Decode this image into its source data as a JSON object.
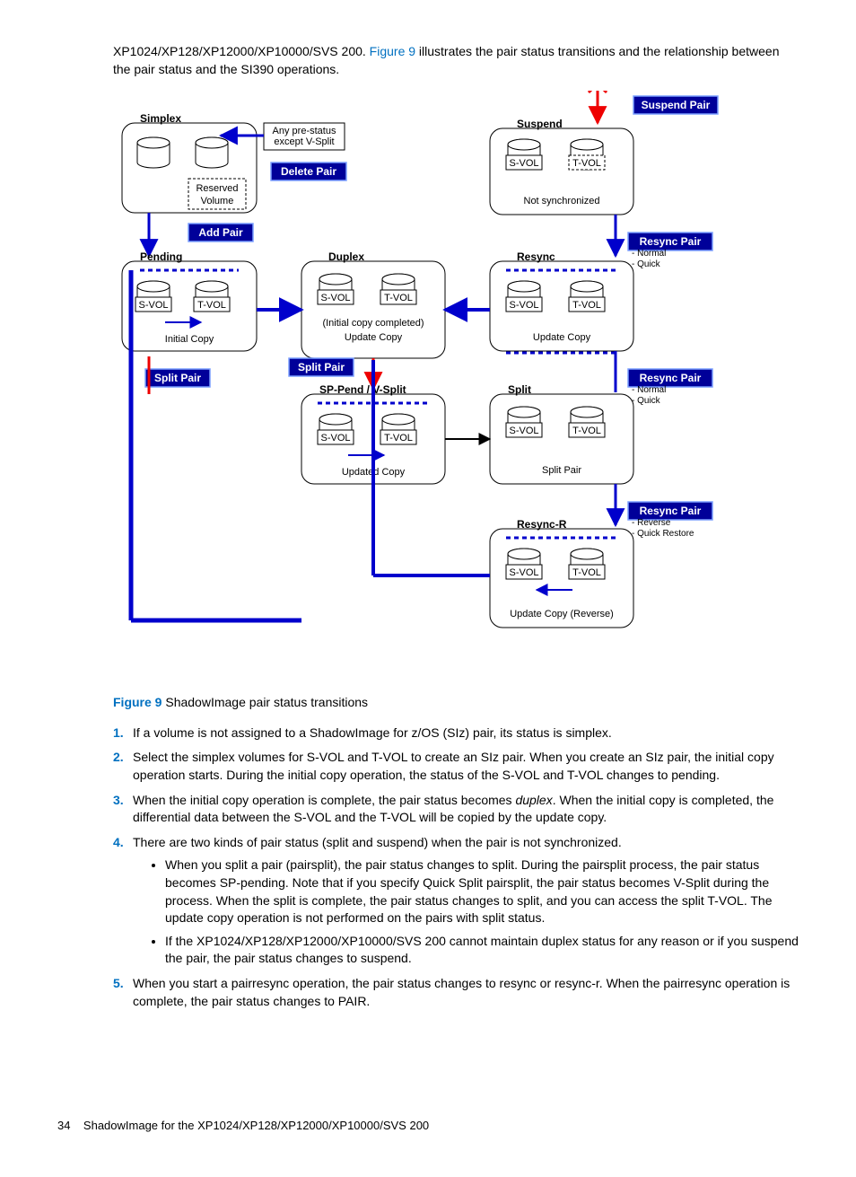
{
  "intro": {
    "prefix": "XP1024/XP128/XP12000/XP10000/SVS 200. ",
    "figref": "Figure 9",
    "suffix": " illustrates the pair status transitions and the relationship between the pair status and the SI390 operations."
  },
  "diagram": {
    "buttons": {
      "suspend": "Suspend Pair",
      "delete": "Delete Pair",
      "add": "Add Pair",
      "resync": "Resync Pair",
      "split": "Split Pair"
    },
    "states": {
      "simplex": "Simplex",
      "pending": "Pending",
      "duplex": "Duplex",
      "suspend": "Suspend",
      "resync": "Resync",
      "sppend": "SP-Pend / V-Split",
      "split": "Split",
      "resyncr": "Resync-R"
    },
    "labels": {
      "anypre1": "Any pre-status",
      "anypre2": "except V-Split",
      "reserved": "Reserved",
      "volume": "Volume",
      "svol": "S-VOL",
      "tvol": "T-VOL",
      "notsync": "Not synchronized",
      "initialcopy": "Initial Copy",
      "initialcomplete": "(Initial copy completed)",
      "updatecopy": "Update Copy",
      "updatedcopy": "Updated Copy",
      "splitpair": "Split Pair",
      "updatecopyrev": "Update Copy (Reverse)",
      "normal": "- Normal",
      "quick": "- Quick",
      "reverse": "- Reverse",
      "quickrestore": "- Quick Restore"
    }
  },
  "caption": {
    "label": "Figure 9",
    "text": "  ShadowImage pair status transitions"
  },
  "list": {
    "i1": "If a volume is not assigned to a ShadowImage for z/OS (SIz) pair, its status is simplex.",
    "i2": "Select the simplex volumes for S-VOL and T-VOL to create an SIz pair. When you create an SIz pair, the initial copy operation starts. During the initial copy operation, the status of the S-VOL and T-VOL changes to pending.",
    "i3a": "When the initial copy operation is complete, the pair status becomes ",
    "i3b": "duplex",
    "i3c": ". When the initial copy is completed, the differential data between the S-VOL and the T-VOL will be copied by the update copy.",
    "i4": "There are two kinds of pair status (split and suspend) when the pair is not synchronized.",
    "i4a": "When you split a pair (pairsplit), the pair status changes to split. During the pairsplit process, the pair status becomes SP-pending. Note that if you specify Quick Split pairsplit, the pair status becomes V-Split during the process. When the split is complete, the pair status changes to split, and you can access the split T-VOL. The update copy operation is not performed on the pairs with split status.",
    "i4b": "If the XP1024/XP128/XP12000/XP10000/SVS 200 cannot maintain duplex status for any reason or if you suspend the pair, the pair status changes to suspend.",
    "i5": "When you start a pairresync operation, the pair status changes to resync or resync-r. When the pairresync operation is complete, the pair status changes to PAIR."
  },
  "footer": {
    "page": "34",
    "title": "ShadowImage for the XP1024/XP128/XP12000/XP10000/SVS 200"
  }
}
